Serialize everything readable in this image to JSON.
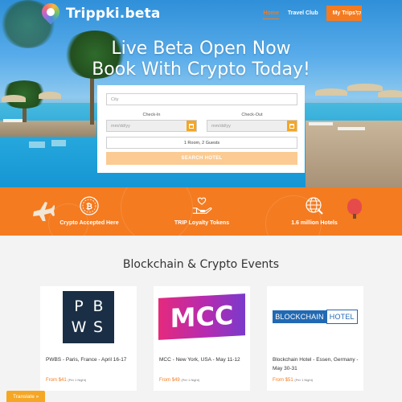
{
  "brand": {
    "name": "Trippki.beta"
  },
  "nav": {
    "items": [
      "Home",
      "Travel Club"
    ],
    "cta": "My Trips",
    "cart_icon": "cart-icon"
  },
  "hero": {
    "line1": "Live Beta Open Now",
    "line2": "Book With Crypto Today!"
  },
  "search": {
    "city_placeholder": "City",
    "checkin_label": "Check-In",
    "checkout_label": "Check-Out",
    "checkin_placeholder": "mm/dd/yy",
    "checkout_placeholder": "mm/dd/yy",
    "guests": "1 Room, 2 Guests",
    "button": "SEARCH HOTEL"
  },
  "features": [
    {
      "label": "Crypto Accepted Here",
      "icon": "bitcoin-icon"
    },
    {
      "label": "TRIP Loyalty Tokens",
      "icon": "hand-heart-icon"
    },
    {
      "label": "1.6 million Hotels",
      "icon": "globe-icon"
    }
  ],
  "events": {
    "title": "Blockchain & Crypto Events",
    "cards": [
      {
        "name": "PWBS - Paris, France - April 16-17",
        "price": "From $41",
        "per": "(Per 1 Night)",
        "logo": [
          "P",
          "B",
          "W",
          "S"
        ]
      },
      {
        "name": "MCC - New York, USA - May 11-12",
        "price": "From $49",
        "per": "(Per 1 Night)",
        "logo": "MCC"
      },
      {
        "name": "Blockchain Hotel - Essen, Germany - May 30-31",
        "price": "From $51",
        "per": "(Per 1 Night)",
        "logo": [
          "BLOCKCHAIN",
          "HOTEL"
        ]
      }
    ]
  },
  "translate": "Translate »",
  "colors": {
    "accent": "#f47b20",
    "search_button": "#fbcb93",
    "calendar": "#f5a623"
  }
}
